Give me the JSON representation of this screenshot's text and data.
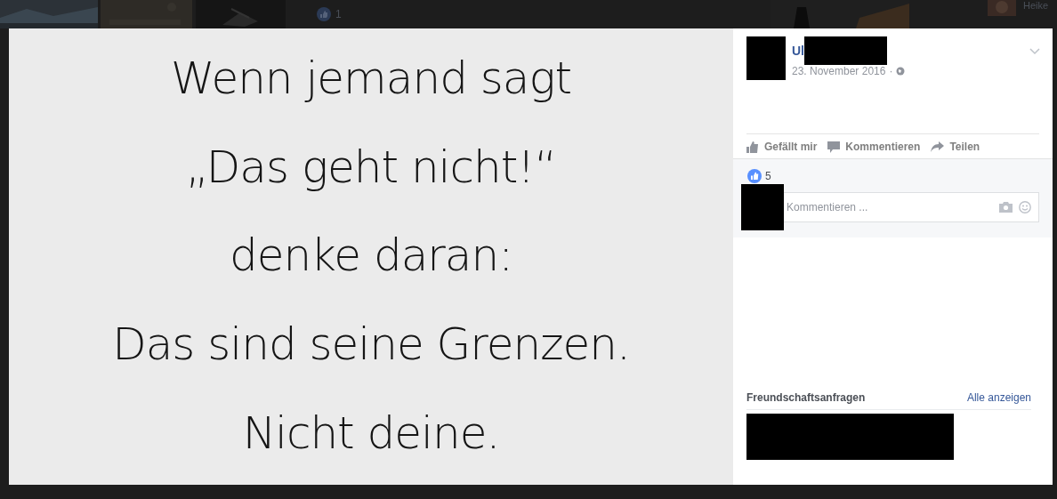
{
  "top_strip": {
    "like_count": "1",
    "person_name": "Heike"
  },
  "post": {
    "author": "Ul",
    "date": "23. November 2016",
    "date_separator": "·",
    "photo_text": [
      "Wenn jemand sagt",
      "„Das geht nicht!“",
      "denke daran:",
      "Das sind seine Grenzen.",
      "Nicht deine."
    ],
    "actions": [
      {
        "kind": "like",
        "label": "Gefällt mir"
      },
      {
        "kind": "comment",
        "label": "Kommentieren"
      },
      {
        "kind": "share",
        "label": "Teilen"
      }
    ],
    "like_count": "5",
    "comment_placeholder": "Kommentieren ..."
  },
  "friend_requests": {
    "title": "Freundschaftsanfragen",
    "link": "Alle anzeigen"
  }
}
